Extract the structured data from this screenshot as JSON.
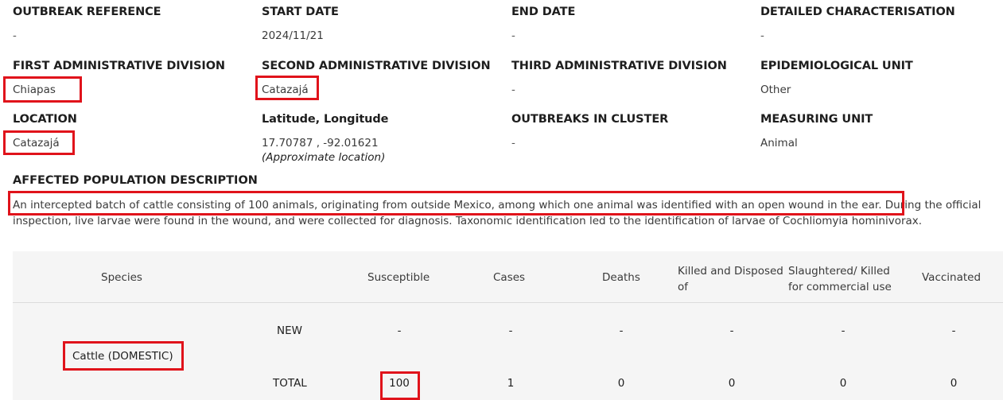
{
  "fields": {
    "outbreak_reference": {
      "label": "OUTBREAK REFERENCE",
      "value": "-"
    },
    "start_date": {
      "label": "START DATE",
      "value": "2024/11/21"
    },
    "end_date": {
      "label": "END DATE",
      "value": "-"
    },
    "detailed_characterisation": {
      "label": "DETAILED CHARACTERISATION",
      "value": "-"
    },
    "first_admin_division": {
      "label": "FIRST ADMINISTRATIVE DIVISION",
      "value": "Chiapas"
    },
    "second_admin_division": {
      "label": "SECOND ADMINISTRATIVE DIVISION",
      "value": "Catazajá"
    },
    "third_admin_division": {
      "label": "THIRD ADMINISTRATIVE DIVISION",
      "value": "-"
    },
    "epidemiological_unit": {
      "label": "EPIDEMIOLOGICAL UNIT",
      "value": "Other"
    },
    "location": {
      "label": "LOCATION",
      "value": "Catazajá"
    },
    "lat_long": {
      "label": "Latitude, Longitude",
      "value": "17.70787 , -92.01621",
      "note": "(Approximate location)"
    },
    "outbreaks_in_cluster": {
      "label": "OUTBREAKS IN CLUSTER",
      "value": "-"
    },
    "measuring_unit": {
      "label": "MEASURING UNIT",
      "value": "Animal"
    }
  },
  "affected_population": {
    "label": "AFFECTED POPULATION DESCRIPTION",
    "text": "An intercepted batch of cattle consisting of 100 animals, originating from outside Mexico, among which one animal was identified with an open wound in the ear. During the official inspection, live larvae were found in the wound, and were collected for diagnosis. Taxonomic identification led to the identification of larvae of Cochliomyia hominivorax."
  },
  "table": {
    "headers": {
      "species": "Species",
      "susceptible": "Susceptible",
      "cases": "Cases",
      "deaths": "Deaths",
      "killed_disposed": "Killed and Disposed of",
      "slaughtered": "Slaughtered/ Killed for commercial use",
      "vaccinated": "Vaccinated"
    },
    "species": "Cattle (DOMESTIC)",
    "rows": [
      {
        "type": "NEW",
        "susceptible": "-",
        "cases": "-",
        "deaths": "-",
        "killed_disposed": "-",
        "slaughtered": "-",
        "vaccinated": "-"
      },
      {
        "type": "TOTAL",
        "susceptible": "100",
        "cases": "1",
        "deaths": "0",
        "killed_disposed": "0",
        "slaughtered": "0",
        "vaccinated": "0"
      }
    ]
  },
  "highlight_color": "#e0131b"
}
